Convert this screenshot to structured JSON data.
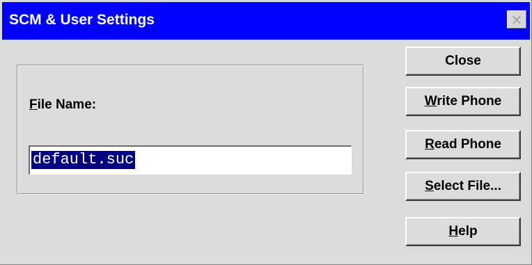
{
  "window": {
    "title": "SCM & User Settings",
    "close_icon": "close-icon"
  },
  "form": {
    "file_name_label": "File Name:",
    "file_name_label_mnemonic": "F",
    "file_name_label_rest": "ile Name:",
    "file_name_value": "default.suc"
  },
  "buttons": {
    "close": "Close",
    "write_phone": {
      "label": "Write Phone",
      "mnemonic": "W",
      "rest": "rite Phone"
    },
    "read_phone": {
      "label": "Read Phone",
      "mnemonic": "R",
      "rest": "ead Phone"
    },
    "select_file": {
      "label": "Select File...",
      "mnemonic": "S",
      "rest": "elect File..."
    },
    "help": {
      "label": "Help",
      "mnemonic": "H",
      "rest": "elp"
    }
  },
  "colors": {
    "titlebar": "#0000ff",
    "selection": "#000080",
    "face": "#dcdcdc"
  }
}
